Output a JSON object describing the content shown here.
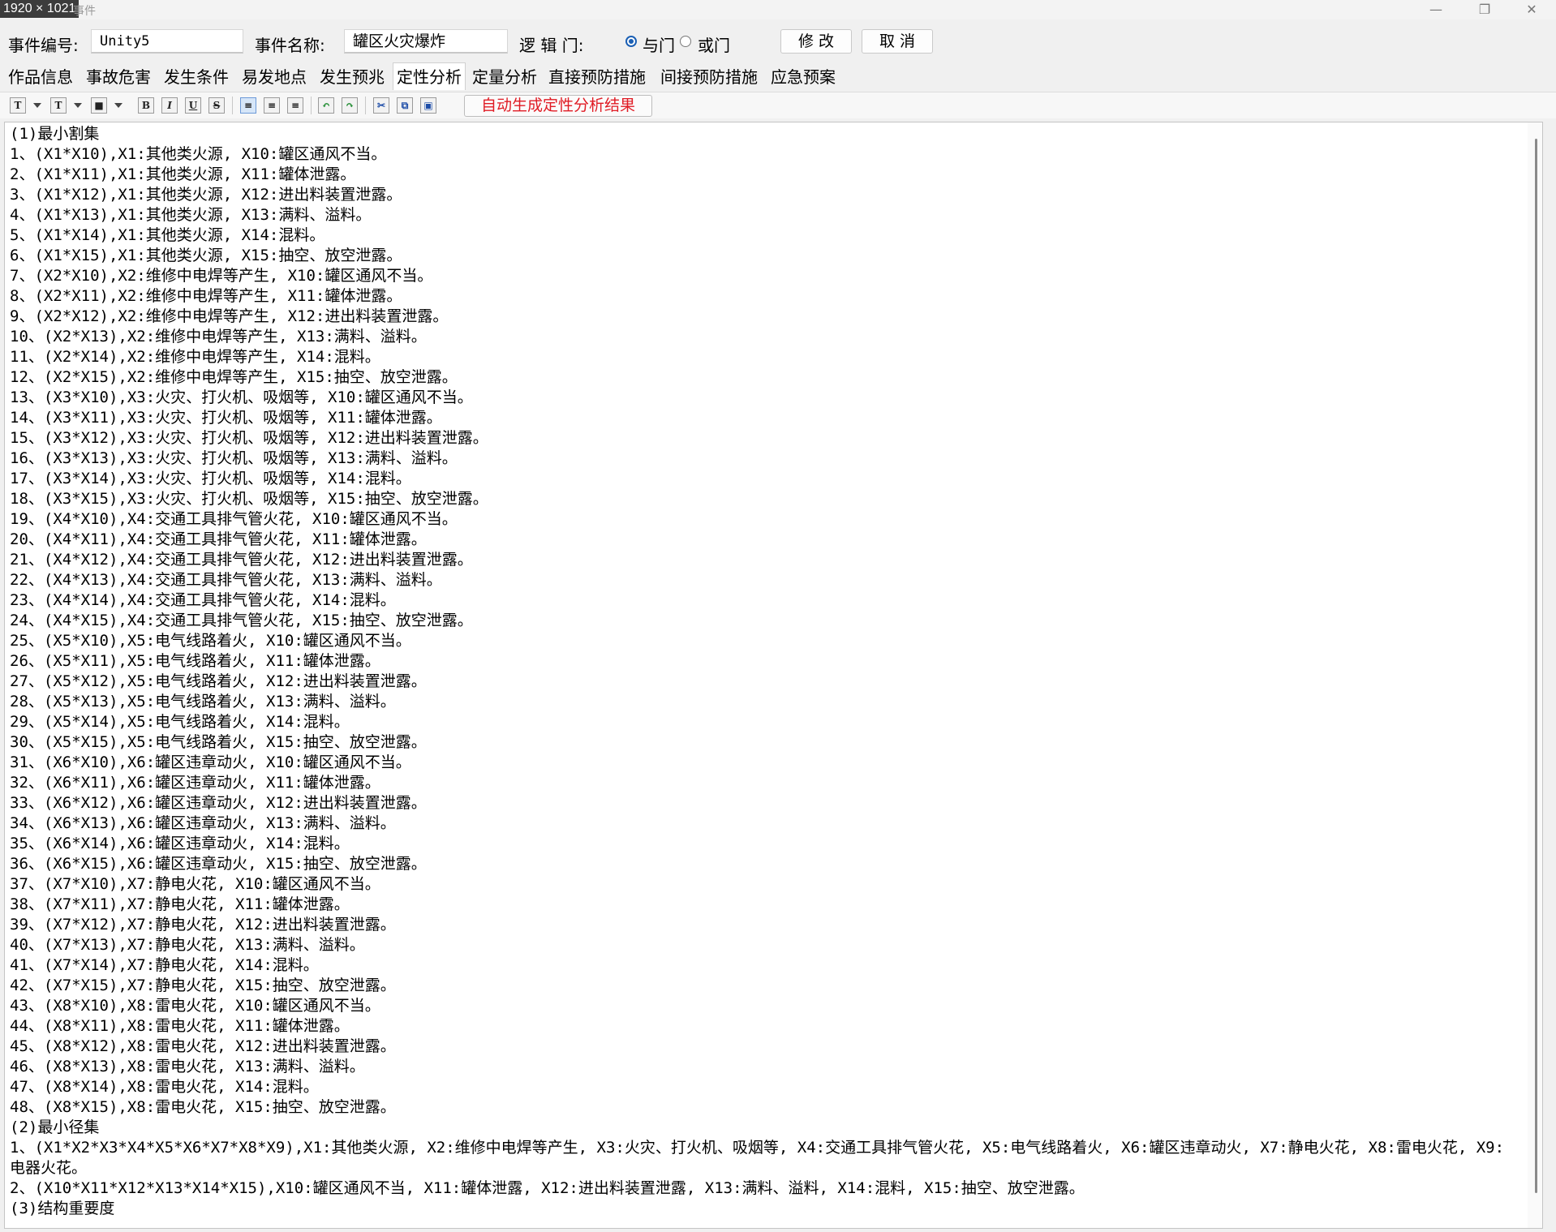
{
  "window": {
    "size_badge": "1920 × 1021",
    "title": "事件",
    "min_icon": "—",
    "max_icon": "❐",
    "close_icon": "✕"
  },
  "header": {
    "event_id_label": "事件编号:",
    "event_id_value": "Unity5",
    "event_name_label": "事件名称:",
    "event_name_value": "罐区火灾爆炸",
    "logic_gate_label": "逻 辑 门:",
    "gate_and": "与门",
    "gate_or": "或门",
    "gate_selected": "与门",
    "modify_button": "修 改",
    "cancel_button": "取 消"
  },
  "tabs": [
    "作品信息",
    "事故危害",
    "发生条件",
    "易发地点",
    "发生预兆",
    "定性分析",
    "定量分析",
    "直接预防措施",
    "间接预防措施",
    "应急预案"
  ],
  "active_tab": "定性分析",
  "toolbar": {
    "font_icon": "T",
    "font_size_icon": "T",
    "color_icon": "■",
    "bold": "B",
    "italic": "I",
    "underline": "U",
    "strike": "S",
    "align_left": "≡",
    "align_center": "≡",
    "align_right": "≡",
    "undo": "↶",
    "redo": "↷",
    "cut": "✂",
    "copy": "⧉",
    "paste": "▣",
    "generate_button": "自动生成定性分析结果"
  },
  "editor": {
    "lines": [
      "(1)最小割集",
      "1、(X1*X10),X1:其他类火源, X10:罐区通风不当。",
      "2、(X1*X11),X1:其他类火源, X11:罐体泄露。",
      "3、(X1*X12),X1:其他类火源, X12:进出料装置泄露。",
      "4、(X1*X13),X1:其他类火源, X13:满料、溢料。",
      "5、(X1*X14),X1:其他类火源, X14:混料。",
      "6、(X1*X15),X1:其他类火源, X15:抽空、放空泄露。",
      "7、(X2*X10),X2:维修中电焊等产生, X10:罐区通风不当。",
      "8、(X2*X11),X2:维修中电焊等产生, X11:罐体泄露。",
      "9、(X2*X12),X2:维修中电焊等产生, X12:进出料装置泄露。",
      "10、(X2*X13),X2:维修中电焊等产生, X13:满料、溢料。",
      "11、(X2*X14),X2:维修中电焊等产生, X14:混料。",
      "12、(X2*X15),X2:维修中电焊等产生, X15:抽空、放空泄露。",
      "13、(X3*X10),X3:火灾、打火机、吸烟等, X10:罐区通风不当。",
      "14、(X3*X11),X3:火灾、打火机、吸烟等, X11:罐体泄露。",
      "15、(X3*X12),X3:火灾、打火机、吸烟等, X12:进出料装置泄露。",
      "16、(X3*X13),X3:火灾、打火机、吸烟等, X13:满料、溢料。",
      "17、(X3*X14),X3:火灾、打火机、吸烟等, X14:混料。",
      "18、(X3*X15),X3:火灾、打火机、吸烟等, X15:抽空、放空泄露。",
      "19、(X4*X10),X4:交通工具排气管火花, X10:罐区通风不当。",
      "20、(X4*X11),X4:交通工具排气管火花, X11:罐体泄露。",
      "21、(X4*X12),X4:交通工具排气管火花, X12:进出料装置泄露。",
      "22、(X4*X13),X4:交通工具排气管火花, X13:满料、溢料。",
      "23、(X4*X14),X4:交通工具排气管火花, X14:混料。",
      "24、(X4*X15),X4:交通工具排气管火花, X15:抽空、放空泄露。",
      "25、(X5*X10),X5:电气线路着火, X10:罐区通风不当。",
      "26、(X5*X11),X5:电气线路着火, X11:罐体泄露。",
      "27、(X5*X12),X5:电气线路着火, X12:进出料装置泄露。",
      "28、(X5*X13),X5:电气线路着火, X13:满料、溢料。",
      "29、(X5*X14),X5:电气线路着火, X14:混料。",
      "30、(X5*X15),X5:电气线路着火, X15:抽空、放空泄露。",
      "31、(X6*X10),X6:罐区违章动火, X10:罐区通风不当。",
      "32、(X6*X11),X6:罐区违章动火, X11:罐体泄露。",
      "33、(X6*X12),X6:罐区违章动火, X12:进出料装置泄露。",
      "34、(X6*X13),X6:罐区违章动火, X13:满料、溢料。",
      "35、(X6*X14),X6:罐区违章动火, X14:混料。",
      "36、(X6*X15),X6:罐区违章动火, X15:抽空、放空泄露。",
      "37、(X7*X10),X7:静电火花, X10:罐区通风不当。",
      "38、(X7*X11),X7:静电火花, X11:罐体泄露。",
      "39、(X7*X12),X7:静电火花, X12:进出料装置泄露。",
      "40、(X7*X13),X7:静电火花, X13:满料、溢料。",
      "41、(X7*X14),X7:静电火花, X14:混料。",
      "42、(X7*X15),X7:静电火花, X15:抽空、放空泄露。",
      "43、(X8*X10),X8:雷电火花, X10:罐区通风不当。",
      "44、(X8*X11),X8:雷电火花, X11:罐体泄露。",
      "45、(X8*X12),X8:雷电火花, X12:进出料装置泄露。",
      "46、(X8*X13),X8:雷电火花, X13:满料、溢料。",
      "47、(X8*X14),X8:雷电火花, X14:混料。",
      "48、(X8*X15),X8:雷电火花, X15:抽空、放空泄露。",
      "(2)最小径集"
    ],
    "path_set_1": "1、(X1*X2*X3*X4*X5*X6*X7*X8*X9),X1:其他类火源, X2:维修中电焊等产生, X3:火灾、打火机、吸烟等, X4:交通工具排气管火花, X5:电气线路着火, X6:罐区违章动火, X7:静电火花, X8:雷电火花, X9:电器火花。",
    "path_set_2": "2、(X10*X11*X12*X13*X14*X15),X10:罐区通风不当, X11:罐体泄露, X12:进出料装置泄露, X13:满料、溢料, X14:混料, X15:抽空、放空泄露。",
    "structure_heading": "(3)结构重要度"
  }
}
